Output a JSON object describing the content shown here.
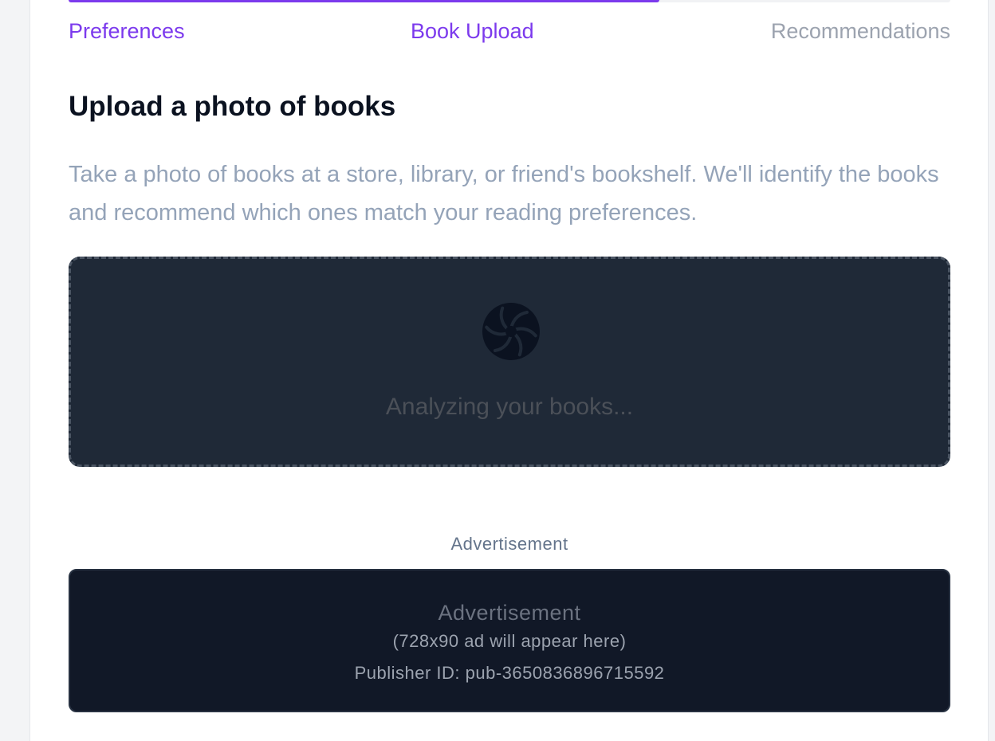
{
  "progress": {
    "fraction": 0.67,
    "accent_color": "#7c3aed",
    "track_color": "#f1f2f4",
    "steps": [
      {
        "label": "Preferences",
        "state": "done"
      },
      {
        "label": "Book Upload",
        "state": "active"
      },
      {
        "label": "Recommendations",
        "state": "todo"
      }
    ]
  },
  "upload": {
    "heading": "Upload a photo of books",
    "description": "Take a photo of books at a store, library, or friend's bookshelf. We'll identify the books and recommend which ones match your reading preferences.",
    "status_text": "Analyzing your books...",
    "spinner_icon": "loading-spinner-icon"
  },
  "ad": {
    "label": "Advertisement",
    "title": "Advertisement",
    "size_text": "(728x90 ad will appear here)",
    "publisher_text": "Publisher ID: pub-3650836896715592"
  }
}
